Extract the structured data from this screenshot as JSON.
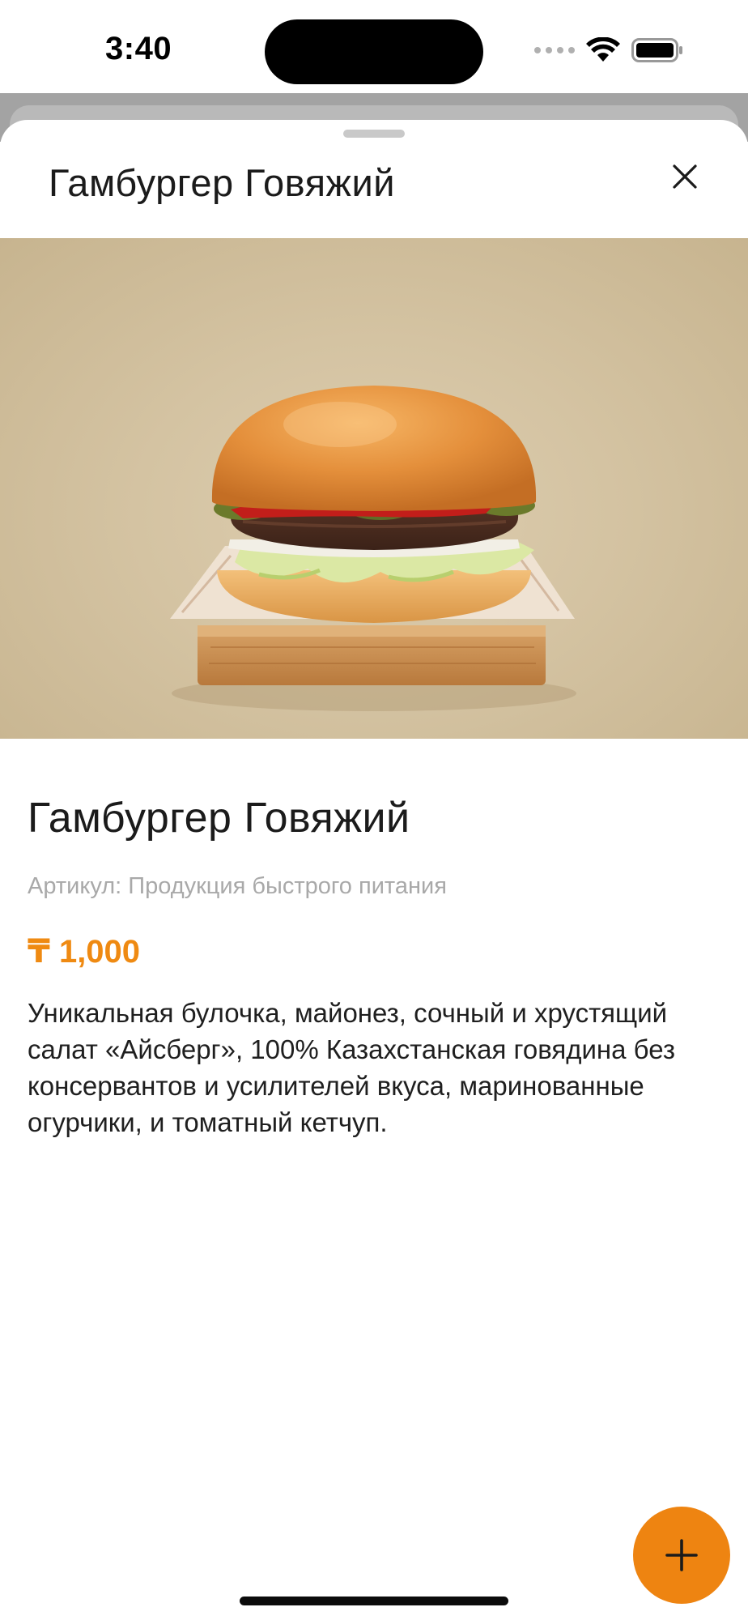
{
  "status_bar": {
    "time": "3:40",
    "icons": [
      "signal-dots-icon",
      "wifi-icon",
      "battery-icon"
    ]
  },
  "sheet": {
    "title": "Гамбургер Говяжий",
    "close_icon": "close-icon"
  },
  "product": {
    "image": "burger-photo",
    "name": "Гамбургер Говяжий",
    "sku_line": "Артикул: Продукция быстрого питания",
    "price": "₸ 1,000",
    "description": "Уникальная булочка, майонез, сочный и хрустящий салат «Айсберг», 100% Казахстанская говядина без консервантов и усилителей вкуса, маринованные огурчики, и томатный кетчуп."
  },
  "actions": {
    "add_icon": "plus-icon"
  },
  "colors": {
    "accent": "#EE8411",
    "price": "#EF8A12",
    "text_primary": "#1B1B1B",
    "text_secondary": "#A9A9A9",
    "photo_background": "#D4C3A2"
  }
}
